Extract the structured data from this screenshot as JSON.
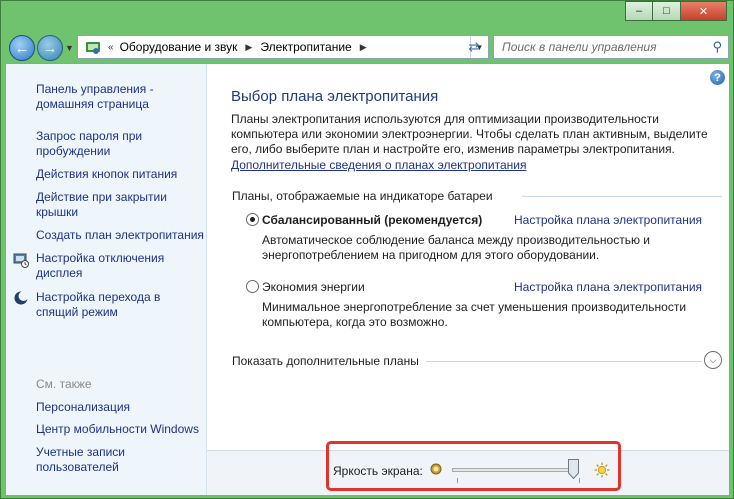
{
  "window": {
    "minimize_glyph": "–",
    "maximize_glyph": "□",
    "close_glyph": "✕"
  },
  "navbar": {
    "back_glyph": "←",
    "forward_glyph": "→",
    "breadcrumb": [
      "Оборудование и звук",
      "Электропитание"
    ],
    "search_placeholder": "Поиск в панели управления"
  },
  "sidebar": {
    "home": "Панель управления - домашняя страница",
    "links": [
      "Запрос пароля при пробуждении",
      "Действия кнопок питания",
      "Действие при закрытии крышки",
      "Создать план электропитания",
      "Настройка отключения дисплея",
      "Настройка перехода в спящий режим"
    ],
    "see_also_heading": "См. также",
    "see_also": [
      "Персонализация",
      "Центр мобильности Windows",
      "Учетные записи пользователей"
    ]
  },
  "main": {
    "title": "Выбор плана электропитания",
    "intro": "Планы электропитания используются для оптимизации производительности компьютера или экономии электроэнергии. Чтобы сделать план активным, выделите его, либо выберите план и настройте его, изменив параметры электропитания.",
    "more_info_link": "Дополнительные сведения о планах электропитания",
    "group_label": "Планы, отображаемые на индикаторе батареи",
    "plans": [
      {
        "name": "Сбалансированный (рекомендуется)",
        "selected": true,
        "settings_link": "Настройка плана электропитания",
        "description": "Автоматическое соблюдение баланса между производительностью и энергопотреблением на пригодном для этого оборудовании."
      },
      {
        "name": "Экономия энергии",
        "selected": false,
        "settings_link": "Настройка плана электропитания",
        "description": "Минимальное энергопотребление за счет уменьшения производительности компьютера, когда это возможно."
      }
    ],
    "show_more_plans": "Показать дополнительные планы"
  },
  "brightness": {
    "label": "Яркость экрана:",
    "level_percent": 100
  },
  "colors": {
    "link": "#1e3287",
    "title": "#1e3c78",
    "highlight": "#e2332d",
    "window_frame": "#6fc26e"
  }
}
